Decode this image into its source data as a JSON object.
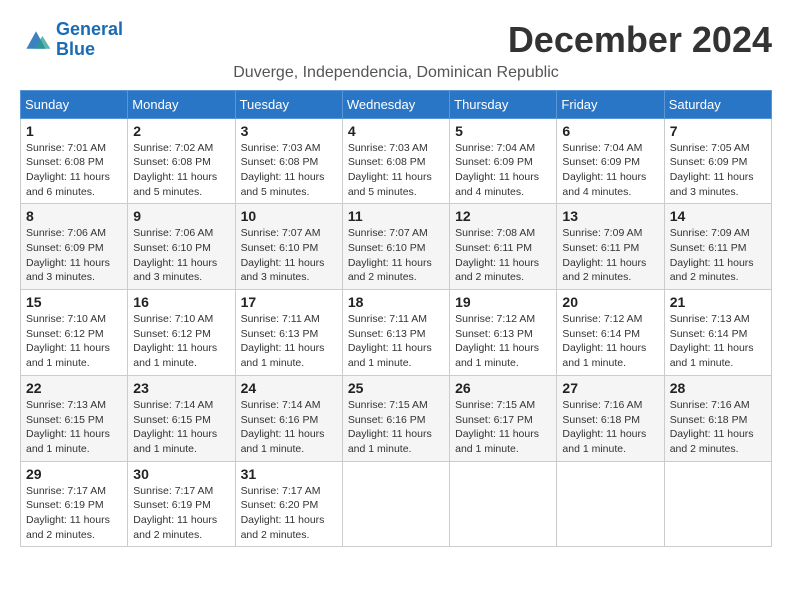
{
  "header": {
    "logo_line1": "General",
    "logo_line2": "Blue",
    "month_title": "December 2024",
    "subtitle": "Duverge, Independencia, Dominican Republic"
  },
  "weekdays": [
    "Sunday",
    "Monday",
    "Tuesday",
    "Wednesday",
    "Thursday",
    "Friday",
    "Saturday"
  ],
  "weeks": [
    [
      {
        "day": "1",
        "sunrise": "7:01 AM",
        "sunset": "6:08 PM",
        "daylight": "11 hours and 6 minutes."
      },
      {
        "day": "2",
        "sunrise": "7:02 AM",
        "sunset": "6:08 PM",
        "daylight": "11 hours and 5 minutes."
      },
      {
        "day": "3",
        "sunrise": "7:03 AM",
        "sunset": "6:08 PM",
        "daylight": "11 hours and 5 minutes."
      },
      {
        "day": "4",
        "sunrise": "7:03 AM",
        "sunset": "6:08 PM",
        "daylight": "11 hours and 5 minutes."
      },
      {
        "day": "5",
        "sunrise": "7:04 AM",
        "sunset": "6:09 PM",
        "daylight": "11 hours and 4 minutes."
      },
      {
        "day": "6",
        "sunrise": "7:04 AM",
        "sunset": "6:09 PM",
        "daylight": "11 hours and 4 minutes."
      },
      {
        "day": "7",
        "sunrise": "7:05 AM",
        "sunset": "6:09 PM",
        "daylight": "11 hours and 3 minutes."
      }
    ],
    [
      {
        "day": "8",
        "sunrise": "7:06 AM",
        "sunset": "6:09 PM",
        "daylight": "11 hours and 3 minutes."
      },
      {
        "day": "9",
        "sunrise": "7:06 AM",
        "sunset": "6:10 PM",
        "daylight": "11 hours and 3 minutes."
      },
      {
        "day": "10",
        "sunrise": "7:07 AM",
        "sunset": "6:10 PM",
        "daylight": "11 hours and 3 minutes."
      },
      {
        "day": "11",
        "sunrise": "7:07 AM",
        "sunset": "6:10 PM",
        "daylight": "11 hours and 2 minutes."
      },
      {
        "day": "12",
        "sunrise": "7:08 AM",
        "sunset": "6:11 PM",
        "daylight": "11 hours and 2 minutes."
      },
      {
        "day": "13",
        "sunrise": "7:09 AM",
        "sunset": "6:11 PM",
        "daylight": "11 hours and 2 minutes."
      },
      {
        "day": "14",
        "sunrise": "7:09 AM",
        "sunset": "6:11 PM",
        "daylight": "11 hours and 2 minutes."
      }
    ],
    [
      {
        "day": "15",
        "sunrise": "7:10 AM",
        "sunset": "6:12 PM",
        "daylight": "11 hours and 1 minute."
      },
      {
        "day": "16",
        "sunrise": "7:10 AM",
        "sunset": "6:12 PM",
        "daylight": "11 hours and 1 minute."
      },
      {
        "day": "17",
        "sunrise": "7:11 AM",
        "sunset": "6:13 PM",
        "daylight": "11 hours and 1 minute."
      },
      {
        "day": "18",
        "sunrise": "7:11 AM",
        "sunset": "6:13 PM",
        "daylight": "11 hours and 1 minute."
      },
      {
        "day": "19",
        "sunrise": "7:12 AM",
        "sunset": "6:13 PM",
        "daylight": "11 hours and 1 minute."
      },
      {
        "day": "20",
        "sunrise": "7:12 AM",
        "sunset": "6:14 PM",
        "daylight": "11 hours and 1 minute."
      },
      {
        "day": "21",
        "sunrise": "7:13 AM",
        "sunset": "6:14 PM",
        "daylight": "11 hours and 1 minute."
      }
    ],
    [
      {
        "day": "22",
        "sunrise": "7:13 AM",
        "sunset": "6:15 PM",
        "daylight": "11 hours and 1 minute."
      },
      {
        "day": "23",
        "sunrise": "7:14 AM",
        "sunset": "6:15 PM",
        "daylight": "11 hours and 1 minute."
      },
      {
        "day": "24",
        "sunrise": "7:14 AM",
        "sunset": "6:16 PM",
        "daylight": "11 hours and 1 minute."
      },
      {
        "day": "25",
        "sunrise": "7:15 AM",
        "sunset": "6:16 PM",
        "daylight": "11 hours and 1 minute."
      },
      {
        "day": "26",
        "sunrise": "7:15 AM",
        "sunset": "6:17 PM",
        "daylight": "11 hours and 1 minute."
      },
      {
        "day": "27",
        "sunrise": "7:16 AM",
        "sunset": "6:18 PM",
        "daylight": "11 hours and 1 minute."
      },
      {
        "day": "28",
        "sunrise": "7:16 AM",
        "sunset": "6:18 PM",
        "daylight": "11 hours and 2 minutes."
      }
    ],
    [
      {
        "day": "29",
        "sunrise": "7:17 AM",
        "sunset": "6:19 PM",
        "daylight": "11 hours and 2 minutes."
      },
      {
        "day": "30",
        "sunrise": "7:17 AM",
        "sunset": "6:19 PM",
        "daylight": "11 hours and 2 minutes."
      },
      {
        "day": "31",
        "sunrise": "7:17 AM",
        "sunset": "6:20 PM",
        "daylight": "11 hours and 2 minutes."
      },
      null,
      null,
      null,
      null
    ]
  ]
}
